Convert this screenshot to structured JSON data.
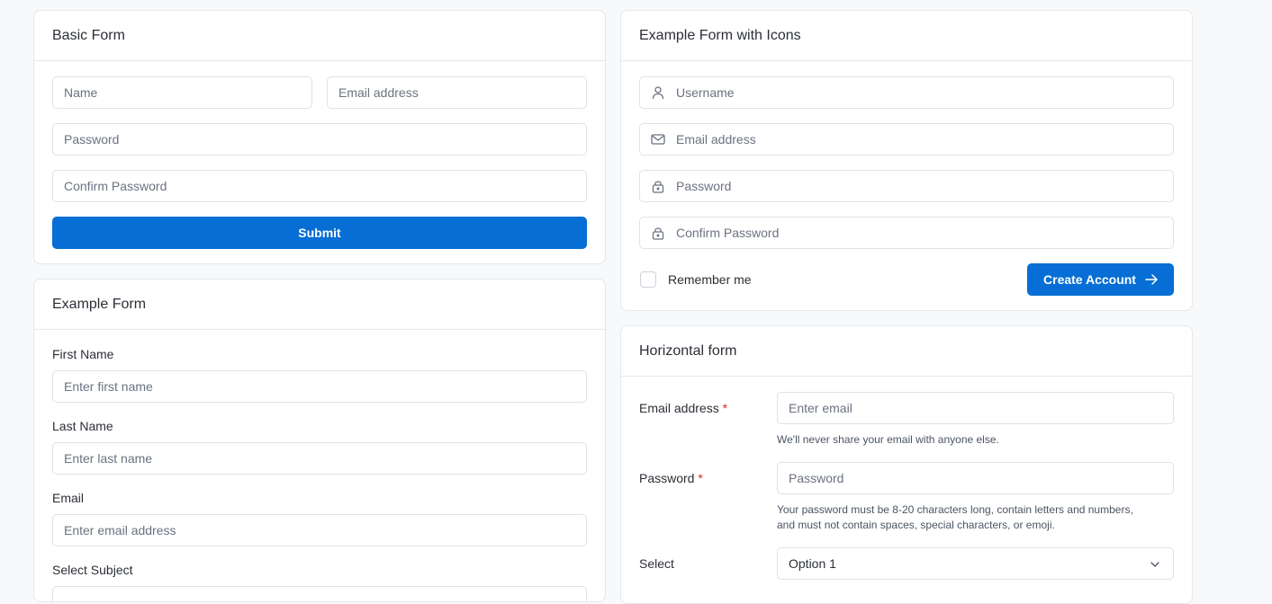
{
  "basic_form": {
    "title": "Basic Form",
    "name_placeholder": "Name",
    "email_placeholder": "Email address",
    "password_placeholder": "Password",
    "confirm_placeholder": "Confirm Password",
    "submit_label": "Submit"
  },
  "icon_form": {
    "title": "Example Form with Icons",
    "username_placeholder": "Username",
    "email_placeholder": "Email address",
    "password_placeholder": "Password",
    "confirm_placeholder": "Confirm Password",
    "remember_label": "Remember me",
    "create_label": "Create Account",
    "icons": [
      "user-icon",
      "mail-icon",
      "lock-icon",
      "lock-icon",
      "arrow-right-icon"
    ]
  },
  "example_form": {
    "title": "Example Form",
    "first_name_label": "First Name",
    "first_name_placeholder": "Enter first name",
    "last_name_label": "Last Name",
    "last_name_placeholder": "Enter last name",
    "email_label": "Email",
    "email_placeholder": "Enter email address",
    "subject_label": "Select Subject"
  },
  "horizontal_form": {
    "title": "Horizontal form",
    "email_label": "Email address",
    "email_placeholder": "Enter email",
    "email_help": "We'll never share your email with anyone else.",
    "password_label": "Password",
    "password_placeholder": "Password",
    "password_help_line1": "Your password must be 8-20 characters long, contain letters and numbers,",
    "password_help_line2": "and must not contain spaces, special characters, or emoji.",
    "required_mark": "*",
    "select_label": "Select",
    "select_value": "Option 1"
  },
  "colors": {
    "primary": "#066ed4",
    "required": "#dc2626",
    "page_bg": "#f8f9fa"
  }
}
